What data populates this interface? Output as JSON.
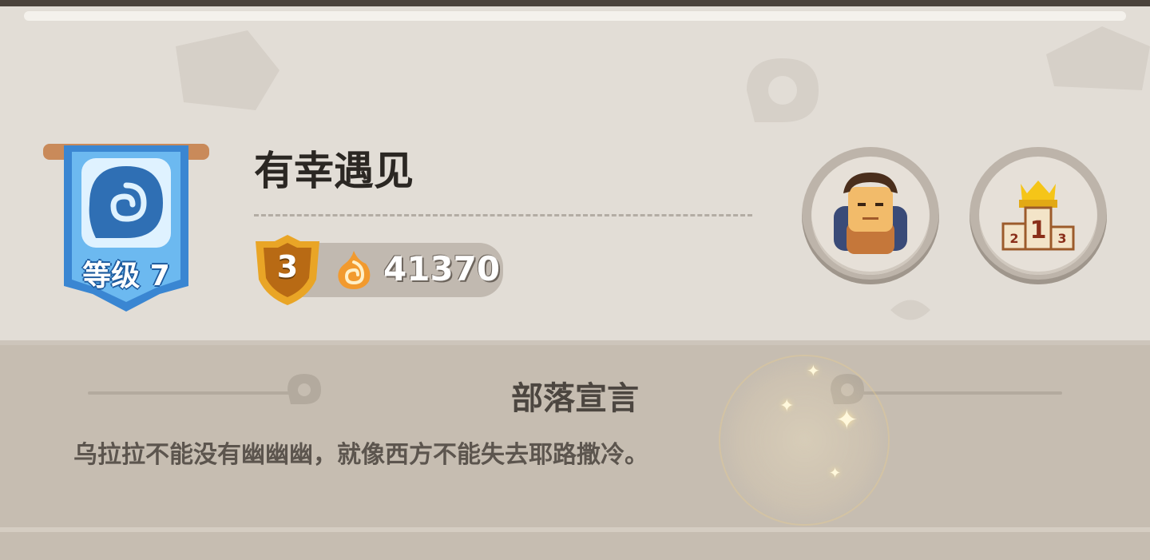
{
  "tribe": {
    "level_label": "等级 7",
    "name": "有幸遇见",
    "rank": "3",
    "score": "41370"
  },
  "buttons": {
    "members_icon": "tribe-member-icon",
    "ranking_icon": "podium-ranking-icon",
    "podium_first": "1",
    "podium_second": "2",
    "podium_third": "3"
  },
  "manifesto": {
    "title": "部落宣言",
    "text": "乌拉拉不能没有幽幽幽，就像西方不能失去耶路撒冷。"
  },
  "colors": {
    "panel_top": "#e2ddd6",
    "panel_bottom": "#c6bdb1",
    "banner_blue": "#3d8fd8",
    "rank_gold": "#e9a526",
    "score_pill": "#c1b9b0"
  }
}
